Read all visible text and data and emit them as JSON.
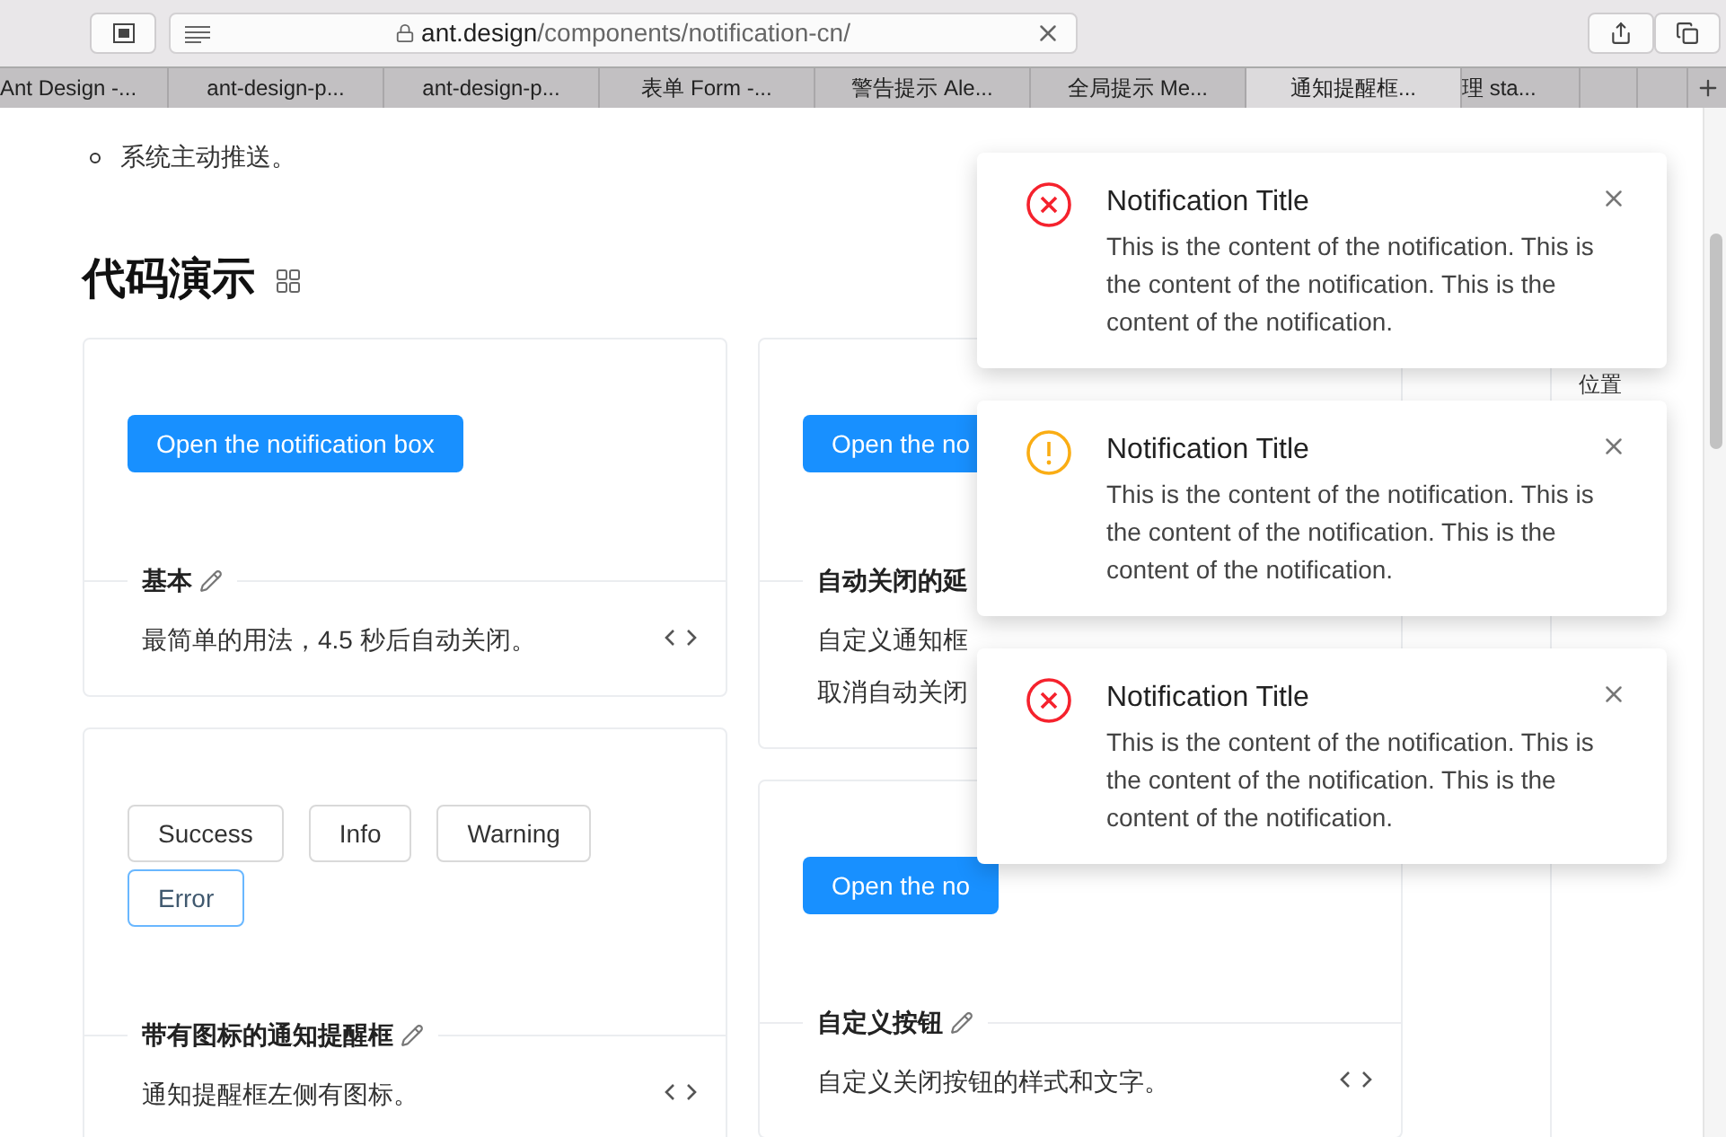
{
  "browser": {
    "address": {
      "host": "ant.design",
      "path": "/components/notification-cn/"
    },
    "tabs": [
      {
        "label": "Ant Design -...",
        "selected": false
      },
      {
        "label": "ant-design-p...",
        "selected": false
      },
      {
        "label": "ant-design-p...",
        "selected": false
      },
      {
        "label": "表单 Form -...",
        "selected": false
      },
      {
        "label": "警告提示 Ale...",
        "selected": false
      },
      {
        "label": "全局提示 Me...",
        "selected": false
      },
      {
        "label": "通知提醒框...",
        "selected": true
      },
      {
        "label": "理 sta...",
        "selected": false
      }
    ]
  },
  "page": {
    "list_items": [
      "系统主动推送。"
    ],
    "heading": "代码演示",
    "columns": [
      [
        {
          "buttons": [
            {
              "label": "Open the notification box",
              "kind": "primary"
            }
          ],
          "title": "基本",
          "pencil": true,
          "description": [
            "最简单的用法，4.5 秒后自动关闭。"
          ],
          "code_icon": true
        },
        {
          "buttons": [
            {
              "label": "Success",
              "kind": "default",
              "focused": false
            },
            {
              "label": "Info",
              "kind": "default",
              "focused": false
            },
            {
              "label": "Warning",
              "kind": "default",
              "focused": false
            },
            {
              "label": "Error",
              "kind": "default",
              "focused": true
            }
          ],
          "title": "带有图标的通知提醒框",
          "pencil": true,
          "description": [
            "通知提醒框左侧有图标。"
          ],
          "code_icon": true
        }
      ],
      [
        {
          "buttons": [
            {
              "label": "Open the no",
              "kind": "primary"
            }
          ],
          "title": "自动关闭的延",
          "pencil": false,
          "description": [
            "自定义通知框",
            "取消自动关闭"
          ],
          "code_icon": false
        },
        {
          "buttons": [
            {
              "label": "Open the no",
              "kind": "primary"
            }
          ],
          "title": "自定义按钮",
          "pencil": true,
          "description": [
            "自定义关闭按钮的样式和文字。"
          ],
          "code_icon": true
        }
      ]
    ],
    "anchor": "位置"
  },
  "notifications": [
    {
      "kind": "error",
      "title": "Notification Title",
      "content": "This is the content of the notification. This is the content of the notification. This is the content of the notification."
    },
    {
      "kind": "warning",
      "title": "Notification Title",
      "content": "This is the content of the notification. This is the content of the notification. This is the content of the notification."
    },
    {
      "kind": "error",
      "title": "Notification Title",
      "content": "This is the content of the notification. This is the content of the notification. This is the content of the notification."
    }
  ]
}
